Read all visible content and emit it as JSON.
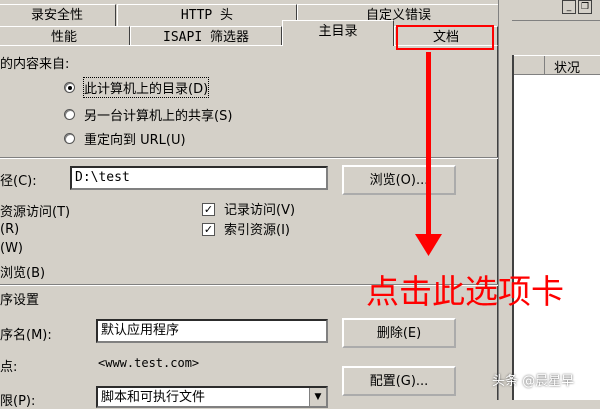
{
  "tabs_row1": [
    "录安全性",
    "HTTP 头",
    "自定义错误"
  ],
  "tabs_row2": [
    "性能",
    "ISAPI 筛选器",
    "主目录",
    "文档"
  ],
  "content_source": {
    "label": "的内容来自:",
    "options": [
      "此计算机上的目录(D)",
      "另一台计算机上的共享(S)",
      "重定向到 URL(U)"
    ],
    "selected_index": 0
  },
  "local_path": {
    "label": "径(C):",
    "value": "D:\\test",
    "browse_label": "浏览(O)..."
  },
  "permissions": {
    "left": [
      "资源访问(T)",
      "(R)",
      "(W)",
      "浏览(B)"
    ],
    "right": [
      {
        "label": "记录访问(V)",
        "checked": true
      },
      {
        "label": "索引资源(I)",
        "checked": true
      }
    ]
  },
  "app_settings": {
    "section_label": "序设置",
    "name_label": "序名(M):",
    "name_value": "默认应用程序",
    "remove_label": "删除(E)",
    "start_label": "点:",
    "start_value": "<www.test.com>",
    "config_label": "配置(G)...",
    "perm_label": "限(P):",
    "perm_value": "脚本和可执行文件"
  },
  "right_pane": {
    "column_header": "状况"
  },
  "annotation": {
    "text": "点击此选项卡",
    "color": "#ff0000"
  },
  "watermark": "头条 @晨星早",
  "icons": [
    "minimize-icon",
    "restore-icon",
    "arrow-down-icon",
    "checkmark-icon",
    "dropdown-arrow-icon"
  ]
}
